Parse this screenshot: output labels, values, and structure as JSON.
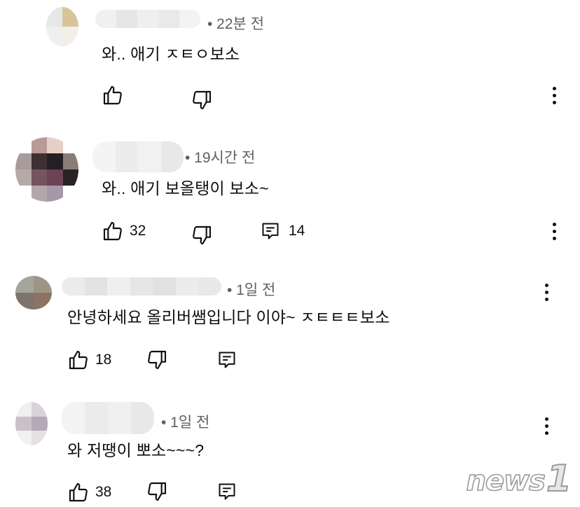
{
  "comments": [
    {
      "time": "• 22분 전",
      "text": "와.. 애기 ㅈㅌㅇ보소",
      "likes": "",
      "replies": ""
    },
    {
      "time": "• 19시간 전",
      "text": "와.. 애기 보올탱이 보소~",
      "likes": "32",
      "replies": "14"
    },
    {
      "time": "• 1일 전",
      "text": "안녕하세요 올리버쌤입니다 이야~ ㅈㅌㅌㅌ보소",
      "likes": "18",
      "replies": ""
    },
    {
      "time": "• 1일 전",
      "text": "와 저땡이 뽀소~~~?",
      "likes": "38",
      "replies": ""
    }
  ],
  "icons": {
    "like": "thumbs-up-icon",
    "dislike": "thumbs-down-icon",
    "reply": "reply-icon",
    "menu": "more-vertical-icon"
  },
  "watermark": {
    "brand": "news",
    "number": "1"
  }
}
